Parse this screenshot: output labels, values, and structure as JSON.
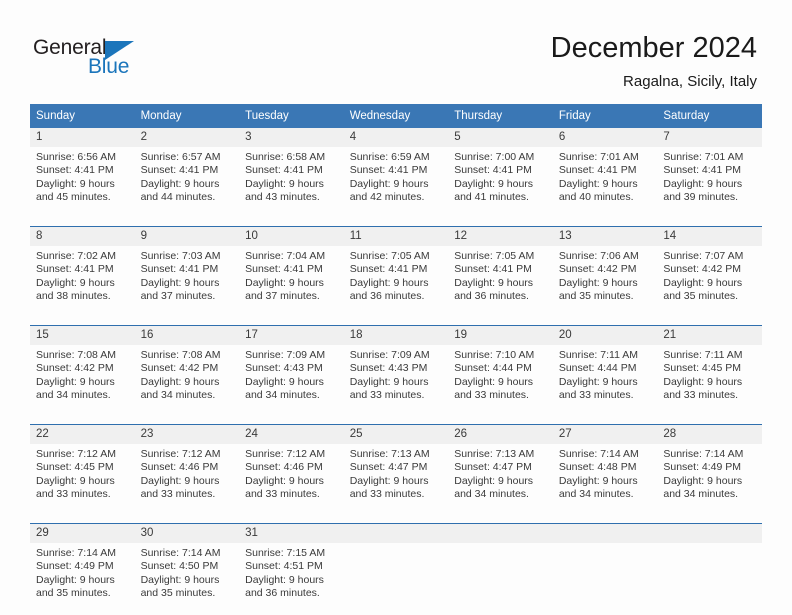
{
  "brand": {
    "name_part1": "General",
    "name_part2": "Blue",
    "logo_icon": "triangle-icon",
    "accent_color": "#1b75bb"
  },
  "header": {
    "month_title": "December 2024",
    "location": "Ragalna, Sicily, Italy"
  },
  "calendar": {
    "header_bg": "#3a77b5",
    "daynum_bg": "#f0f0f0",
    "row_border_color": "#2f6fae",
    "weekday_headers": [
      "Sunday",
      "Monday",
      "Tuesday",
      "Wednesday",
      "Thursday",
      "Friday",
      "Saturday"
    ],
    "weeks": [
      [
        {
          "day": "1",
          "sunrise": "Sunrise: 6:56 AM",
          "sunset": "Sunset: 4:41 PM",
          "daylight1": "Daylight: 9 hours",
          "daylight2": "and 45 minutes."
        },
        {
          "day": "2",
          "sunrise": "Sunrise: 6:57 AM",
          "sunset": "Sunset: 4:41 PM",
          "daylight1": "Daylight: 9 hours",
          "daylight2": "and 44 minutes."
        },
        {
          "day": "3",
          "sunrise": "Sunrise: 6:58 AM",
          "sunset": "Sunset: 4:41 PM",
          "daylight1": "Daylight: 9 hours",
          "daylight2": "and 43 minutes."
        },
        {
          "day": "4",
          "sunrise": "Sunrise: 6:59 AM",
          "sunset": "Sunset: 4:41 PM",
          "daylight1": "Daylight: 9 hours",
          "daylight2": "and 42 minutes."
        },
        {
          "day": "5",
          "sunrise": "Sunrise: 7:00 AM",
          "sunset": "Sunset: 4:41 PM",
          "daylight1": "Daylight: 9 hours",
          "daylight2": "and 41 minutes."
        },
        {
          "day": "6",
          "sunrise": "Sunrise: 7:01 AM",
          "sunset": "Sunset: 4:41 PM",
          "daylight1": "Daylight: 9 hours",
          "daylight2": "and 40 minutes."
        },
        {
          "day": "7",
          "sunrise": "Sunrise: 7:01 AM",
          "sunset": "Sunset: 4:41 PM",
          "daylight1": "Daylight: 9 hours",
          "daylight2": "and 39 minutes."
        }
      ],
      [
        {
          "day": "8",
          "sunrise": "Sunrise: 7:02 AM",
          "sunset": "Sunset: 4:41 PM",
          "daylight1": "Daylight: 9 hours",
          "daylight2": "and 38 minutes."
        },
        {
          "day": "9",
          "sunrise": "Sunrise: 7:03 AM",
          "sunset": "Sunset: 4:41 PM",
          "daylight1": "Daylight: 9 hours",
          "daylight2": "and 37 minutes."
        },
        {
          "day": "10",
          "sunrise": "Sunrise: 7:04 AM",
          "sunset": "Sunset: 4:41 PM",
          "daylight1": "Daylight: 9 hours",
          "daylight2": "and 37 minutes."
        },
        {
          "day": "11",
          "sunrise": "Sunrise: 7:05 AM",
          "sunset": "Sunset: 4:41 PM",
          "daylight1": "Daylight: 9 hours",
          "daylight2": "and 36 minutes."
        },
        {
          "day": "12",
          "sunrise": "Sunrise: 7:05 AM",
          "sunset": "Sunset: 4:41 PM",
          "daylight1": "Daylight: 9 hours",
          "daylight2": "and 36 minutes."
        },
        {
          "day": "13",
          "sunrise": "Sunrise: 7:06 AM",
          "sunset": "Sunset: 4:42 PM",
          "daylight1": "Daylight: 9 hours",
          "daylight2": "and 35 minutes."
        },
        {
          "day": "14",
          "sunrise": "Sunrise: 7:07 AM",
          "sunset": "Sunset: 4:42 PM",
          "daylight1": "Daylight: 9 hours",
          "daylight2": "and 35 minutes."
        }
      ],
      [
        {
          "day": "15",
          "sunrise": "Sunrise: 7:08 AM",
          "sunset": "Sunset: 4:42 PM",
          "daylight1": "Daylight: 9 hours",
          "daylight2": "and 34 minutes."
        },
        {
          "day": "16",
          "sunrise": "Sunrise: 7:08 AM",
          "sunset": "Sunset: 4:42 PM",
          "daylight1": "Daylight: 9 hours",
          "daylight2": "and 34 minutes."
        },
        {
          "day": "17",
          "sunrise": "Sunrise: 7:09 AM",
          "sunset": "Sunset: 4:43 PM",
          "daylight1": "Daylight: 9 hours",
          "daylight2": "and 34 minutes."
        },
        {
          "day": "18",
          "sunrise": "Sunrise: 7:09 AM",
          "sunset": "Sunset: 4:43 PM",
          "daylight1": "Daylight: 9 hours",
          "daylight2": "and 33 minutes."
        },
        {
          "day": "19",
          "sunrise": "Sunrise: 7:10 AM",
          "sunset": "Sunset: 4:44 PM",
          "daylight1": "Daylight: 9 hours",
          "daylight2": "and 33 minutes."
        },
        {
          "day": "20",
          "sunrise": "Sunrise: 7:11 AM",
          "sunset": "Sunset: 4:44 PM",
          "daylight1": "Daylight: 9 hours",
          "daylight2": "and 33 minutes."
        },
        {
          "day": "21",
          "sunrise": "Sunrise: 7:11 AM",
          "sunset": "Sunset: 4:45 PM",
          "daylight1": "Daylight: 9 hours",
          "daylight2": "and 33 minutes."
        }
      ],
      [
        {
          "day": "22",
          "sunrise": "Sunrise: 7:12 AM",
          "sunset": "Sunset: 4:45 PM",
          "daylight1": "Daylight: 9 hours",
          "daylight2": "and 33 minutes."
        },
        {
          "day": "23",
          "sunrise": "Sunrise: 7:12 AM",
          "sunset": "Sunset: 4:46 PM",
          "daylight1": "Daylight: 9 hours",
          "daylight2": "and 33 minutes."
        },
        {
          "day": "24",
          "sunrise": "Sunrise: 7:12 AM",
          "sunset": "Sunset: 4:46 PM",
          "daylight1": "Daylight: 9 hours",
          "daylight2": "and 33 minutes."
        },
        {
          "day": "25",
          "sunrise": "Sunrise: 7:13 AM",
          "sunset": "Sunset: 4:47 PM",
          "daylight1": "Daylight: 9 hours",
          "daylight2": "and 33 minutes."
        },
        {
          "day": "26",
          "sunrise": "Sunrise: 7:13 AM",
          "sunset": "Sunset: 4:47 PM",
          "daylight1": "Daylight: 9 hours",
          "daylight2": "and 34 minutes."
        },
        {
          "day": "27",
          "sunrise": "Sunrise: 7:14 AM",
          "sunset": "Sunset: 4:48 PM",
          "daylight1": "Daylight: 9 hours",
          "daylight2": "and 34 minutes."
        },
        {
          "day": "28",
          "sunrise": "Sunrise: 7:14 AM",
          "sunset": "Sunset: 4:49 PM",
          "daylight1": "Daylight: 9 hours",
          "daylight2": "and 34 minutes."
        }
      ],
      [
        {
          "day": "29",
          "sunrise": "Sunrise: 7:14 AM",
          "sunset": "Sunset: 4:49 PM",
          "daylight1": "Daylight: 9 hours",
          "daylight2": "and 35 minutes."
        },
        {
          "day": "30",
          "sunrise": "Sunrise: 7:14 AM",
          "sunset": "Sunset: 4:50 PM",
          "daylight1": "Daylight: 9 hours",
          "daylight2": "and 35 minutes."
        },
        {
          "day": "31",
          "sunrise": "Sunrise: 7:15 AM",
          "sunset": "Sunset: 4:51 PM",
          "daylight1": "Daylight: 9 hours",
          "daylight2": "and 36 minutes."
        },
        {
          "day": "",
          "sunrise": "",
          "sunset": "",
          "daylight1": "",
          "daylight2": ""
        },
        {
          "day": "",
          "sunrise": "",
          "sunset": "",
          "daylight1": "",
          "daylight2": ""
        },
        {
          "day": "",
          "sunrise": "",
          "sunset": "",
          "daylight1": "",
          "daylight2": ""
        },
        {
          "day": "",
          "sunrise": "",
          "sunset": "",
          "daylight1": "",
          "daylight2": ""
        }
      ]
    ]
  }
}
